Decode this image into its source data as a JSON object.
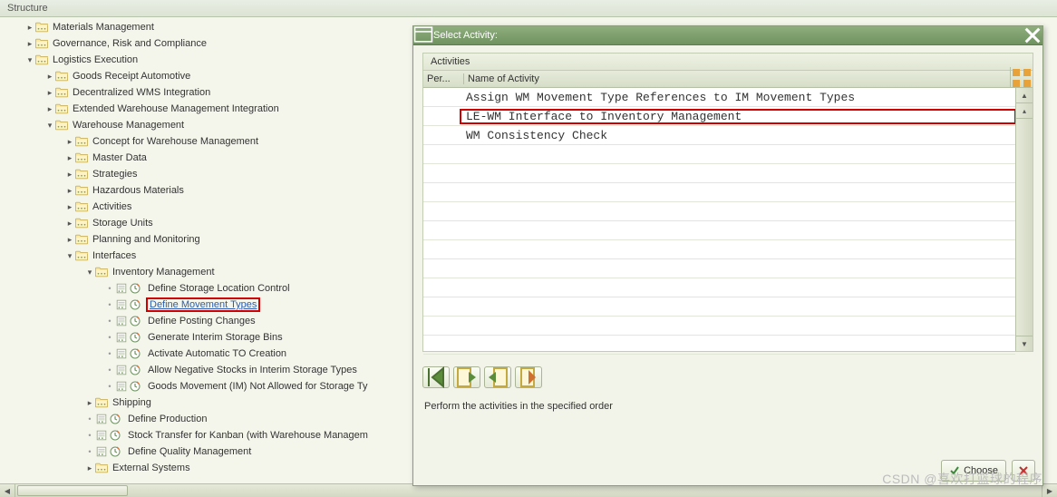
{
  "panel_title": "Structure",
  "tree": [
    {
      "ind": 1,
      "tog": "▸",
      "ic": "folder",
      "lbl": "Materials Management"
    },
    {
      "ind": 1,
      "tog": "▸",
      "ic": "folder",
      "lbl": "Governance, Risk and Compliance"
    },
    {
      "ind": 1,
      "tog": "▾",
      "ic": "folder",
      "lbl": "Logistics Execution"
    },
    {
      "ind": 2,
      "tog": "▸",
      "ic": "folder",
      "lbl": "Goods Receipt Automotive"
    },
    {
      "ind": 2,
      "tog": "▸",
      "ic": "folder",
      "lbl": "Decentralized WMS Integration"
    },
    {
      "ind": 2,
      "tog": "▸",
      "ic": "folder",
      "lbl": "Extended Warehouse Management Integration"
    },
    {
      "ind": 2,
      "tog": "▾",
      "ic": "folder",
      "lbl": "Warehouse Management"
    },
    {
      "ind": 3,
      "tog": "▸",
      "ic": "folder",
      "lbl": "Concept for Warehouse Management"
    },
    {
      "ind": 3,
      "tog": "▸",
      "ic": "folder",
      "lbl": "Master Data"
    },
    {
      "ind": 3,
      "tog": "▸",
      "ic": "folder",
      "lbl": "Strategies"
    },
    {
      "ind": 3,
      "tog": "▸",
      "ic": "folder",
      "lbl": "Hazardous Materials"
    },
    {
      "ind": 3,
      "tog": "▸",
      "ic": "folder",
      "lbl": "Activities"
    },
    {
      "ind": 3,
      "tog": "▸",
      "ic": "folder",
      "lbl": "Storage Units"
    },
    {
      "ind": 3,
      "tog": "▸",
      "ic": "folder",
      "lbl": "Planning and Monitoring"
    },
    {
      "ind": 3,
      "tog": "▾",
      "ic": "folder",
      "lbl": "Interfaces"
    },
    {
      "ind": 4,
      "tog": "▾",
      "ic": "folder",
      "lbl": "Inventory Management"
    },
    {
      "ind": 5,
      "tog": "·",
      "ic": "doc",
      "clk": true,
      "lbl": "Define Storage Location Control"
    },
    {
      "ind": 5,
      "tog": "·",
      "ic": "doc",
      "clk": true,
      "lbl": "Define Movement Types",
      "sel": true,
      "box": true
    },
    {
      "ind": 5,
      "tog": "·",
      "ic": "doc",
      "clk": true,
      "lbl": "Define Posting Changes"
    },
    {
      "ind": 5,
      "tog": "·",
      "ic": "doc",
      "clk": true,
      "lbl": "Generate Interim Storage Bins"
    },
    {
      "ind": 5,
      "tog": "·",
      "ic": "doc",
      "clk": true,
      "lbl": "Activate Automatic TO Creation"
    },
    {
      "ind": 5,
      "tog": "·",
      "ic": "doc",
      "clk": true,
      "lbl": "Allow Negative Stocks in Interim Storage Types"
    },
    {
      "ind": 5,
      "tog": "·",
      "ic": "doc",
      "clk": true,
      "lbl": "Goods Movement (IM) Not Allowed for Storage Ty"
    },
    {
      "ind": 4,
      "tog": "▸",
      "ic": "folder",
      "lbl": "Shipping"
    },
    {
      "ind": 4,
      "tog": "·",
      "ic": "doc",
      "clk": true,
      "lbl": "Define Production"
    },
    {
      "ind": 4,
      "tog": "·",
      "ic": "doc",
      "clk": true,
      "lbl": "Stock Transfer for Kanban (with Warehouse Managem"
    },
    {
      "ind": 4,
      "tog": "·",
      "ic": "doc",
      "clk": true,
      "lbl": "Define Quality Management"
    },
    {
      "ind": 4,
      "tog": "▸",
      "ic": "folder",
      "lbl": "External Systems"
    }
  ],
  "dialog": {
    "title": "Select Activity:",
    "group": "Activities",
    "col_per": "Per...",
    "col_name": "Name of Activity",
    "rows": [
      {
        "name": "Assign WM Movement Type References to IM Movement Types",
        "hl": false
      },
      {
        "name": "LE-WM Interface to Inventory Management",
        "hl": true
      },
      {
        "name": "WM Consistency Check",
        "hl": false
      }
    ],
    "blank_rows": 11,
    "hint": "Perform the activities in the specified order",
    "choose": "Choose"
  },
  "watermark": "CSDN @喜欢打篮球的程序"
}
